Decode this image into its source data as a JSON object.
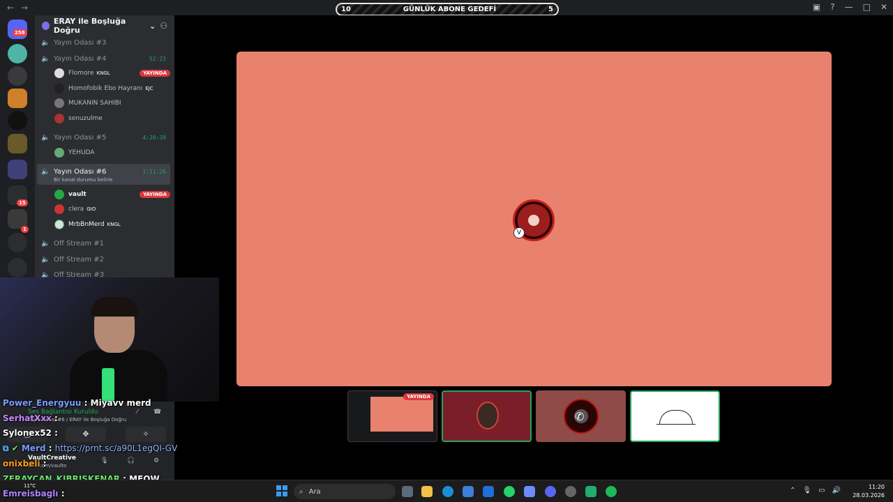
{
  "goal_bar": {
    "left": "10",
    "title": "GÜNLÜK ABONE GEDEFİ",
    "right": "5"
  },
  "server_rail": {
    "badge_top": "258",
    "badge_mid": "15",
    "badge_low": "1"
  },
  "server": {
    "name": "ERAY ile Boşluğa Doğru"
  },
  "channels": [
    {
      "name": "Yayın Odası #3"
    },
    {
      "name": "Yayın Odası #4",
      "time": "52:23"
    },
    {
      "name": "Yayın Odası #5",
      "time": "4:20:39"
    },
    {
      "name": "Yayın Odası #6",
      "time": "1:11:26",
      "status": "Bir kanal durumu belirle"
    },
    {
      "name": "Off Stream #1"
    },
    {
      "name": "Off Stream #2"
    },
    {
      "name": "Off Stream #3"
    }
  ],
  "users_4": [
    {
      "name": "Flomore",
      "tag": "KNGL",
      "live": "YAYINDA"
    },
    {
      "name": "Homofobik Ebo Hayranı",
      "tag": "EJC"
    },
    {
      "name": "MUKANIN SAHIBI"
    },
    {
      "name": "senuzulme"
    }
  ],
  "users_5": [
    {
      "name": "YEHUDA"
    }
  ],
  "users_6": [
    {
      "name": "vault",
      "live": "YAYINDA"
    },
    {
      "name": "clera",
      "tag": "GIO"
    },
    {
      "name": "MrbBnMerd",
      "tag": "KNGL"
    }
  ],
  "stream": {
    "live_label": "YAYINDA"
  },
  "voice_panel": {
    "status": "Ses Bağlantısı Kuruldu",
    "channel": "Yayın Odası #6 / ERAY ile Boşluğa Doğru",
    "user": "VaultCreative",
    "sub": "kick.com/vaulto"
  },
  "chat": [
    {
      "user": "Power_Energyuu",
      "msg": "Miyavv merd"
    },
    {
      "user": "SerhatXxx",
      "msg": ""
    },
    {
      "user": "Sylonex52",
      "msg": ""
    },
    {
      "user": "Merd",
      "msg": "https://prnt.sc/a90L1egQI-GV"
    },
    {
      "user": "onixbeli",
      "msg": ""
    },
    {
      "user": "ZERAYCAN_KIBRISKENAR",
      "msg": "MEOW"
    },
    {
      "user": "Emreisbaglı",
      "msg": ""
    }
  ],
  "taskbar": {
    "search": "Ara",
    "time": "11:20",
    "date": "28.03.2026",
    "weather": "11°C"
  }
}
